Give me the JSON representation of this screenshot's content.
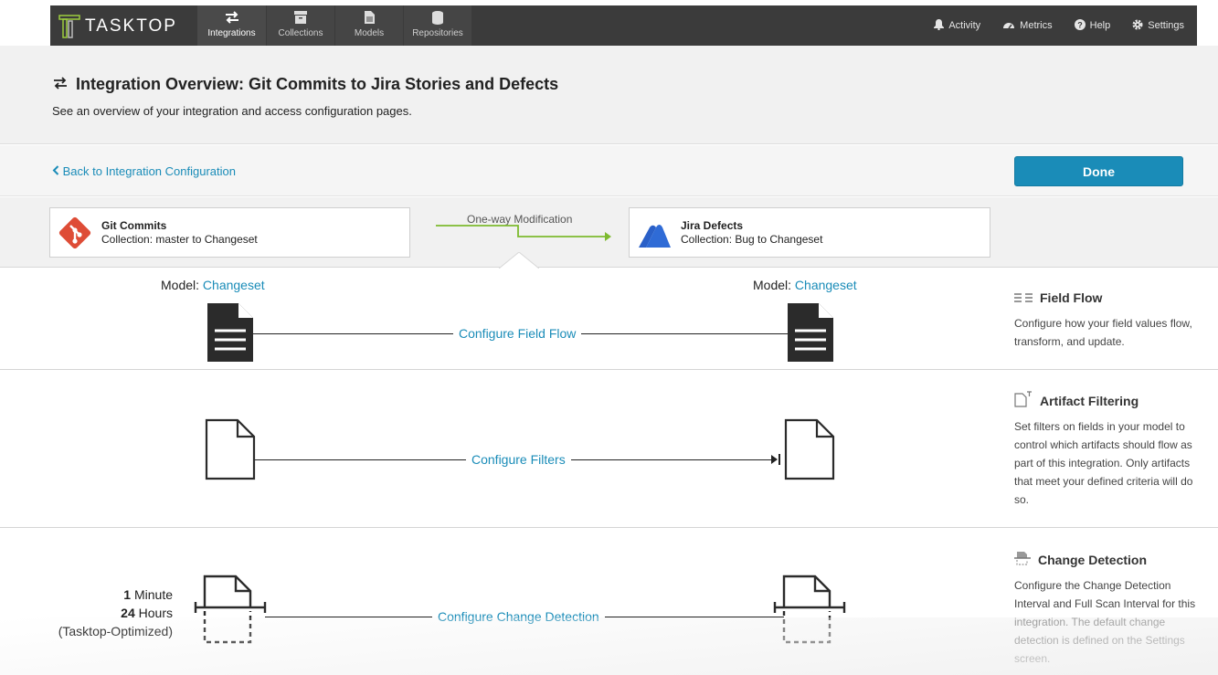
{
  "brand": {
    "name": "TASKTOP"
  },
  "nav": {
    "items": [
      {
        "label": "Integrations",
        "icon": "arrows-exchange-icon",
        "active": true
      },
      {
        "label": "Collections",
        "icon": "archive-box-icon",
        "active": false
      },
      {
        "label": "Models",
        "icon": "document-icon",
        "active": false
      },
      {
        "label": "Repositories",
        "icon": "database-icon",
        "active": false
      }
    ],
    "right": [
      {
        "label": "Activity",
        "icon": "bell-icon"
      },
      {
        "label": "Metrics",
        "icon": "gauge-icon"
      },
      {
        "label": "Help",
        "icon": "question-circle-icon"
      },
      {
        "label": "Settings",
        "icon": "gear-icon"
      }
    ]
  },
  "header": {
    "title": "Integration Overview: Git Commits to Jira Stories and Defects",
    "subtitle": "See an overview of your integration and access configuration pages."
  },
  "actions": {
    "back_label": "Back to Integration Configuration",
    "done_label": "Done"
  },
  "collections": {
    "source": {
      "name": "Git Commits",
      "desc": "Collection: master to Changeset"
    },
    "target": {
      "name": "Jira Defects",
      "desc": "Collection: Bug to Changeset"
    },
    "flow_label": "One-way Modification"
  },
  "field_flow": {
    "model_prefix": "Model:",
    "source_model": "Changeset",
    "target_model": "Changeset",
    "link": "Configure Field Flow",
    "side_title": "Field Flow",
    "side_desc": "Configure how your field values flow, transform, and update."
  },
  "artifact_filtering": {
    "link": "Configure Filters",
    "side_title": "Artifact Filtering",
    "side_desc": "Set filters on fields in your model to control which artifacts should flow as part of this integration. Only artifacts that meet your defined criteria will do so."
  },
  "change_detection": {
    "interval_value": "1",
    "interval_unit": "Minute",
    "full_scan_value": "24",
    "full_scan_unit": "Hours",
    "optimized_note": "(Tasktop-Optimized)",
    "link": "Configure Change Detection",
    "side_title": "Change Detection",
    "side_desc": "Configure the Change Detection Interval and Full Scan Interval for this integration. The default change detection is defined on the Settings screen."
  },
  "colors": {
    "accent": "#1a8cb8",
    "flow_arrow": "#7dba2f",
    "nav_bg": "#3b3b3b",
    "git": "#de4c36",
    "jira": "#2a60c8"
  }
}
